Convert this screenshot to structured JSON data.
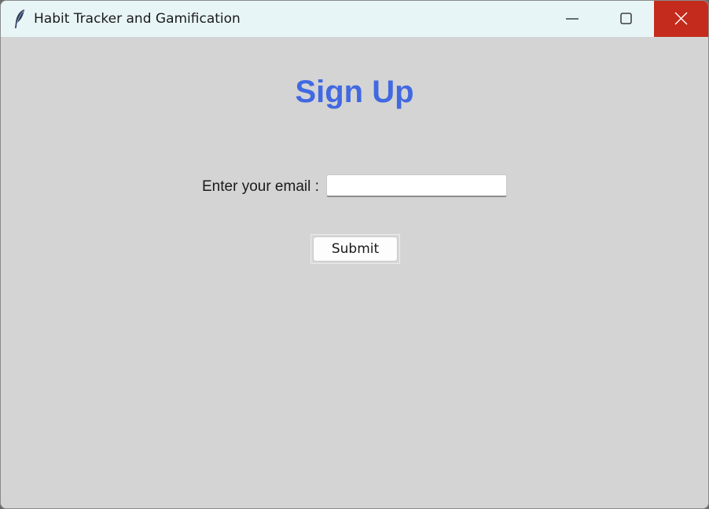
{
  "window": {
    "title": "Habit Tracker and Gamification",
    "app_icon": "feather-icon",
    "controls": {
      "minimize_icon": "minimize-icon",
      "maximize_icon": "maximize-icon",
      "close_icon": "close-icon",
      "close_color": "#c42b1c"
    }
  },
  "form": {
    "heading": "Sign Up",
    "heading_color": "#4169e1",
    "email_label": "Enter your email :",
    "email_value": "",
    "submit_label": "Submit"
  },
  "colors": {
    "titlebar": "#e8f5f7",
    "background": "#d4d4d4"
  }
}
